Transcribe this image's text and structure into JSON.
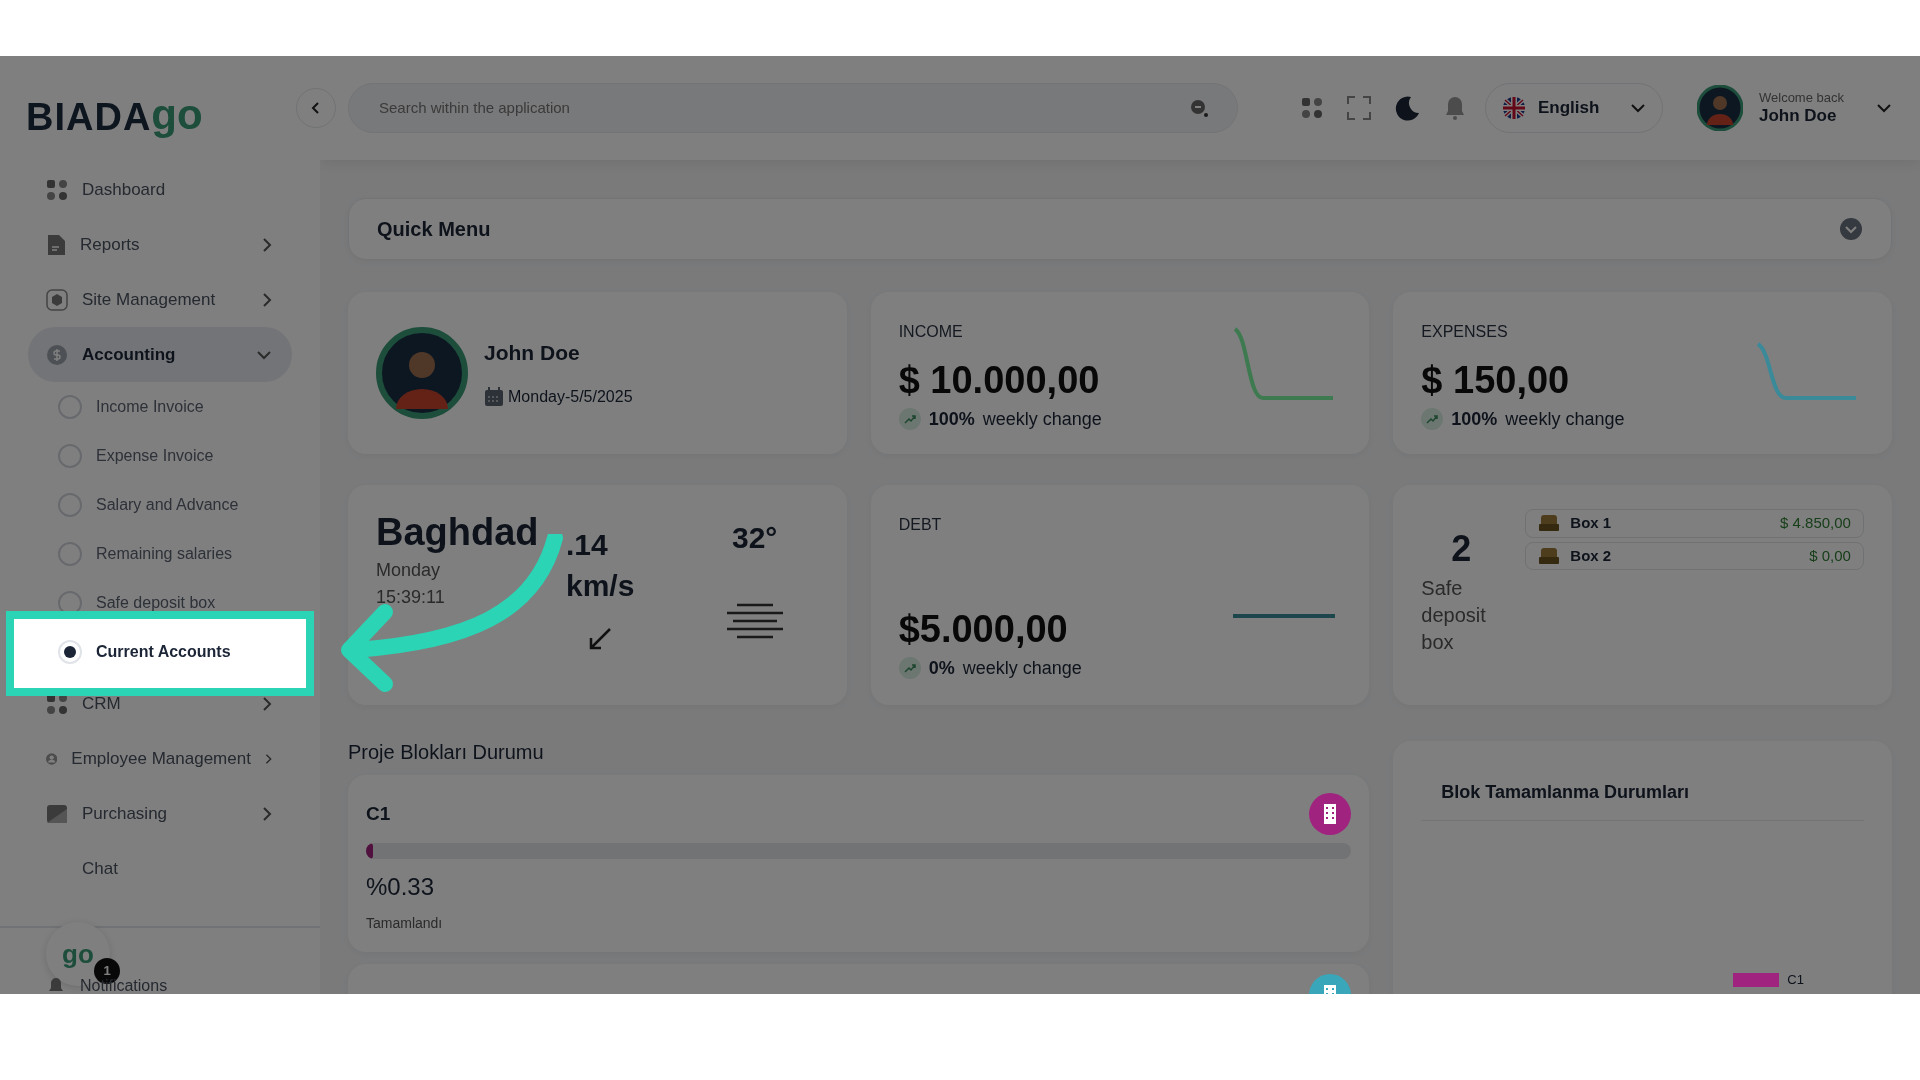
{
  "logo": {
    "text": "BIADA",
    "accent": "go"
  },
  "sidebar": {
    "items": [
      {
        "label": "Dashboard",
        "submenu": false,
        "selected": false
      },
      {
        "label": "Reports",
        "submenu": true,
        "expanded": false,
        "selected": false
      },
      {
        "label": "Site Management",
        "submenu": true,
        "expanded": false,
        "selected": false
      },
      {
        "label": "Accounting",
        "submenu": true,
        "expanded": true,
        "selected": true,
        "children": [
          {
            "label": "Income Invoice",
            "selected": false
          },
          {
            "label": "Expense Invoice",
            "selected": false
          },
          {
            "label": "Salary and Advance",
            "selected": false
          },
          {
            "label": "Remaining salaries",
            "selected": false
          },
          {
            "label": "Safe deposit box",
            "selected": false
          },
          {
            "label": "Current Accounts",
            "selected": true
          }
        ]
      },
      {
        "label": "CRM",
        "submenu": true,
        "expanded": false,
        "selected": false
      },
      {
        "label": "Employee Management",
        "submenu": true,
        "expanded": false,
        "selected": false
      },
      {
        "label": "Purchasing",
        "submenu": true,
        "expanded": false,
        "selected": false
      },
      {
        "label": "Chat",
        "submenu": false,
        "selected": false
      }
    ],
    "assistant": {
      "logo": "go",
      "badge": "1"
    },
    "notifications": "Notifications"
  },
  "header": {
    "search": {
      "placeholder": "Search within the application"
    },
    "language": "English",
    "greeting": "Welcome back",
    "user": "John Doe"
  },
  "quick_menu": {
    "title": "Quick Menu"
  },
  "profile_card": {
    "name": "John Doe",
    "date": "Monday-5/5/2025"
  },
  "stats": [
    {
      "label": "INCOME",
      "amount": "$ 10.000,00",
      "percent": "100%",
      "change": "weekly change",
      "color": "#3d7a4f"
    },
    {
      "label": "EXPENSES",
      "amount": "$ 150,00",
      "percent": "100%",
      "change": "weekly change",
      "color": "#3a8a99"
    }
  ],
  "weather": {
    "city": "Baghdad",
    "day": "Monday",
    "time": "15:39:11",
    "wind": ".14",
    "wind_unit": "km/s",
    "temperature": "32°"
  },
  "debt": {
    "label": "DEBT",
    "amount": "$5.000,00",
    "percent": "0%",
    "change": "weekly change"
  },
  "safe": {
    "count": "2",
    "label": "Safe deposit box",
    "boxes": [
      {
        "name": "Box 1",
        "amount": "$ 4.850,00"
      },
      {
        "name": "Box 2",
        "amount": "$ 0,00"
      }
    ]
  },
  "projects": {
    "title": "Proje Blokları Durumu",
    "blocks": [
      {
        "name": "C1",
        "level": 0.0033,
        "percent": "%0.33",
        "status": "Tamamlandı",
        "color": "#a0237f"
      },
      {
        "color": "#3aa6b9"
      }
    ]
  },
  "completion": {
    "title": "Blok Tamamlanma Durumları",
    "legend": [
      {
        "label": "C1",
        "color": "#a0237f"
      }
    ]
  }
}
